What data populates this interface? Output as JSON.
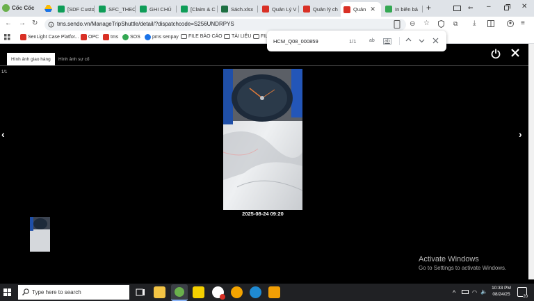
{
  "browser": {
    "brand": "Cốc Cốc",
    "tabs": [
      {
        "label": "[SDF Custo",
        "color": "#0f9d58"
      },
      {
        "label": "SFC_THEO",
        "color": "#0f9d58"
      },
      {
        "label": "GHI CHÚ",
        "color": "#0f9d58"
      },
      {
        "label": "[Claim & C",
        "color": "#0f9d58"
      },
      {
        "label": "Sách.xlsx",
        "color": "#1d6f42"
      },
      {
        "label": "Quản Lý V",
        "color": "#d93025"
      },
      {
        "label": "Quản lý ch",
        "color": "#d93025"
      },
      {
        "label": "Quản",
        "color": "#d93025",
        "active": true
      },
      {
        "label": "In biên bả",
        "color": "#34a853"
      }
    ],
    "url": "tms.sendo.vn/ManageTripShuttle/detail/?dispatchcode=S256UNDRPYS",
    "bookmarks": [
      {
        "label": "SenLight Case Platfor...",
        "icon": "sendo-icon",
        "color": "#d93025"
      },
      {
        "label": "OPC",
        "icon": "sendo-icon",
        "color": "#d93025"
      },
      {
        "label": "tms",
        "icon": "sendo-icon",
        "color": "#d93025"
      },
      {
        "label": "SOS",
        "icon": "sos-icon",
        "color": "#34a853"
      },
      {
        "label": "pms senpay",
        "icon": "p-icon",
        "color": "#1a73e8"
      },
      {
        "label": "FILE BÁO CÁO",
        "icon": "folder-icon",
        "color": "#555"
      },
      {
        "label": "TÀI LIỆU",
        "icon": "folder-icon",
        "color": "#555"
      },
      {
        "label": "FIL",
        "icon": "folder-icon",
        "color": "#555"
      }
    ]
  },
  "find": {
    "query": "HCM_Q08_000859",
    "count": "1/1",
    "case_label": "ab",
    "word_label": "ab"
  },
  "viewer": {
    "tab_active": "Hình ảnh giao hàng",
    "tab_inactive": "Hình ảnh sự cố",
    "counter": "1/1",
    "timestamp": "2025-08-24 09:20"
  },
  "watermark": {
    "line1": "Activate Windows",
    "line2": "Go to Settings to activate Windows."
  },
  "taskbar": {
    "search_placeholder": "Type here to search",
    "time": "10:33 PM",
    "date": "08/24/25",
    "notifications": "20"
  }
}
